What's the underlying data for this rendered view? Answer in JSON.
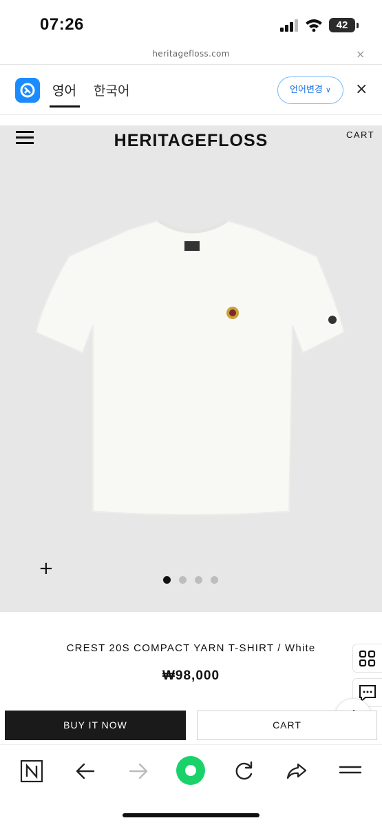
{
  "status_bar": {
    "time": "07:26",
    "battery": "42"
  },
  "url_bar": {
    "url": "heritagefloss.com",
    "close_label": "×"
  },
  "translation_bar": {
    "tab_active": "영어",
    "tab_other": "한국어",
    "language_button": "언어변경",
    "close_label": "×"
  },
  "site_header": {
    "brand": "HERITAGEFLOSS",
    "cart": "CART"
  },
  "gallery": {
    "plus": "+",
    "slide_count": 4,
    "active_slide": 0
  },
  "product": {
    "name": "CREST 20S COMPACT YARN T-SHIRT / White",
    "price": "₩98,000",
    "buy_now": "BUY IT NOW",
    "cart": "CART"
  },
  "colors": {
    "hero_background": "#e7e7e7",
    "primary_button": "#1a1a1a",
    "accent_blue": "#1a8cff",
    "home_green": "#19d36a"
  },
  "icons": {
    "status": [
      "signal-icon",
      "wifi-icon",
      "battery-icon"
    ],
    "side": [
      "grid-icon",
      "chat-icon",
      "arrow-up-icon"
    ],
    "toolbar": [
      "naver-n-icon",
      "back-arrow-icon",
      "forward-arrow-icon",
      "green-home-icon",
      "refresh-icon",
      "share-icon",
      "menu-icon"
    ]
  }
}
